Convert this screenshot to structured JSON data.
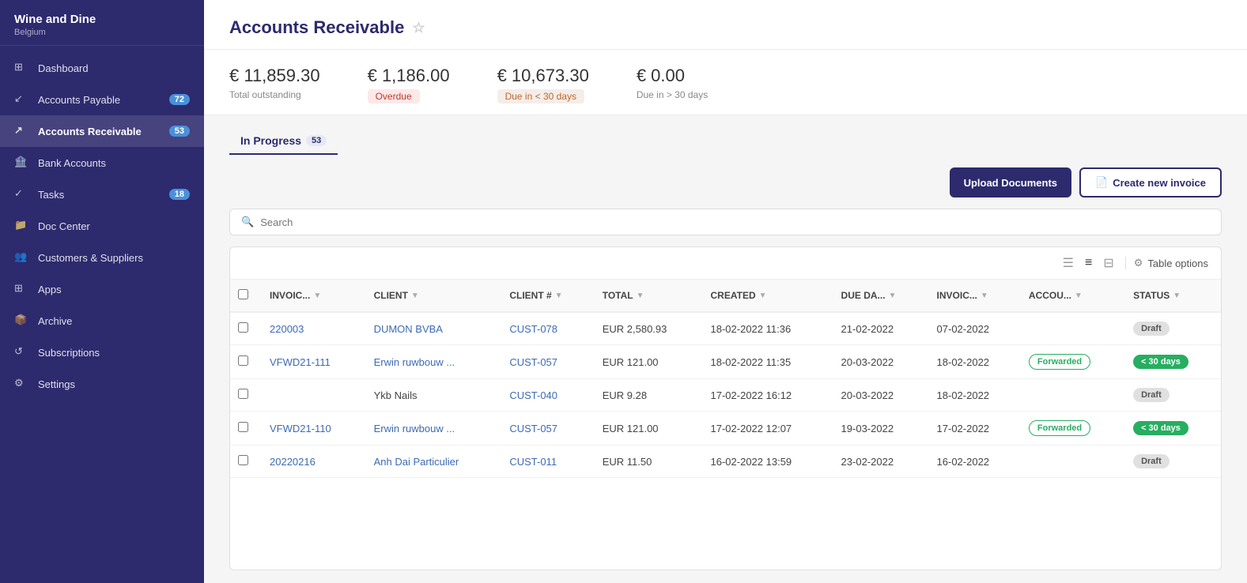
{
  "sidebar": {
    "company": "Wine and Dine",
    "country": "Belgium",
    "collapse_icon": "←",
    "nav_items": [
      {
        "id": "dashboard",
        "label": "Dashboard",
        "badge": null,
        "active": false
      },
      {
        "id": "accounts-payable",
        "label": "Accounts Payable",
        "badge": "72",
        "active": false
      },
      {
        "id": "accounts-receivable",
        "label": "Accounts Receivable",
        "badge": "53",
        "active": true
      },
      {
        "id": "bank-accounts",
        "label": "Bank Accounts",
        "badge": null,
        "active": false
      },
      {
        "id": "tasks",
        "label": "Tasks",
        "badge": "18",
        "active": false
      },
      {
        "id": "doc-center",
        "label": "Doc Center",
        "badge": null,
        "active": false
      },
      {
        "id": "customers-suppliers",
        "label": "Customers & Suppliers",
        "badge": null,
        "active": false
      },
      {
        "id": "apps",
        "label": "Apps",
        "badge": null,
        "active": false
      },
      {
        "id": "archive",
        "label": "Archive",
        "badge": null,
        "active": false
      },
      {
        "id": "subscriptions",
        "label": "Subscriptions",
        "badge": null,
        "active": false
      },
      {
        "id": "settings",
        "label": "Settings",
        "badge": null,
        "active": false
      }
    ]
  },
  "page": {
    "title": "Accounts Receivable",
    "star": "☆"
  },
  "stats": [
    {
      "amount": "€ 11,859.30",
      "label": "Total outstanding",
      "badge": null
    },
    {
      "amount": "€ 1,186.00",
      "label": null,
      "badge": "Overdue",
      "badge_class": "overdue"
    },
    {
      "amount": "€ 10,673.30",
      "label": null,
      "badge": "Due in < 30 days",
      "badge_class": "due-30"
    },
    {
      "amount": "€ 0.00",
      "label": "Due in > 30 days",
      "badge": null
    }
  ],
  "tabs": [
    {
      "label": "In Progress",
      "count": "53",
      "active": true
    }
  ],
  "buttons": {
    "upload": "Upload Documents",
    "create": "Create new invoice"
  },
  "search": {
    "placeholder": "Search"
  },
  "table_options": "Table options",
  "columns": [
    {
      "key": "invoice",
      "label": "INVOIC..."
    },
    {
      "key": "client",
      "label": "CLIENT"
    },
    {
      "key": "client_num",
      "label": "CLIENT #"
    },
    {
      "key": "total",
      "label": "TOTAL"
    },
    {
      "key": "created",
      "label": "CREATED"
    },
    {
      "key": "due_date",
      "label": "DUE DA..."
    },
    {
      "key": "invoice2",
      "label": "INVOIC..."
    },
    {
      "key": "account",
      "label": "ACCOU..."
    },
    {
      "key": "status",
      "label": "STATUS"
    }
  ],
  "rows": [
    {
      "invoice": "220003",
      "client": "DUMON BVBA",
      "client_num": "CUST-078",
      "total": "EUR 2,580.93",
      "created": "18-02-2022 11:36",
      "due_date": "21-02-2022",
      "invoice2": "07-02-2022",
      "account": "",
      "status": "Draft",
      "status_class": "draft",
      "forwarded": null,
      "client_link": true
    },
    {
      "invoice": "VFWD21-111",
      "client": "Erwin ruwbouw ...",
      "client_num": "CUST-057",
      "total": "EUR 121.00",
      "created": "18-02-2022 11:35",
      "due_date": "20-03-2022",
      "invoice2": "18-02-2022",
      "account": "Forwarded",
      "status": "< 30 days",
      "status_class": "lt30",
      "forwarded": "Forwarded",
      "client_link": true
    },
    {
      "invoice": "",
      "client": "Ykb Nails",
      "client_num": "CUST-040",
      "total": "EUR 9.28",
      "created": "17-02-2022 16:12",
      "due_date": "20-03-2022",
      "invoice2": "18-02-2022",
      "account": "",
      "status": "Draft",
      "status_class": "draft",
      "forwarded": null,
      "client_link": false
    },
    {
      "invoice": "VFWD21-110",
      "client": "Erwin ruwbouw ...",
      "client_num": "CUST-057",
      "total": "EUR 121.00",
      "created": "17-02-2022 12:07",
      "due_date": "19-03-2022",
      "invoice2": "17-02-2022",
      "account": "Forwarded",
      "status": "< 30 days",
      "status_class": "lt30",
      "forwarded": "Forwarded",
      "client_link": true
    },
    {
      "invoice": "20220216",
      "client": "Anh Dai Particulier",
      "client_num": "CUST-011",
      "total": "EUR 11.50",
      "created": "16-02-2022 13:59",
      "due_date": "23-02-2022",
      "invoice2": "16-02-2022",
      "account": "",
      "status": "Draft",
      "status_class": "draft",
      "forwarded": null,
      "client_link": true
    }
  ]
}
